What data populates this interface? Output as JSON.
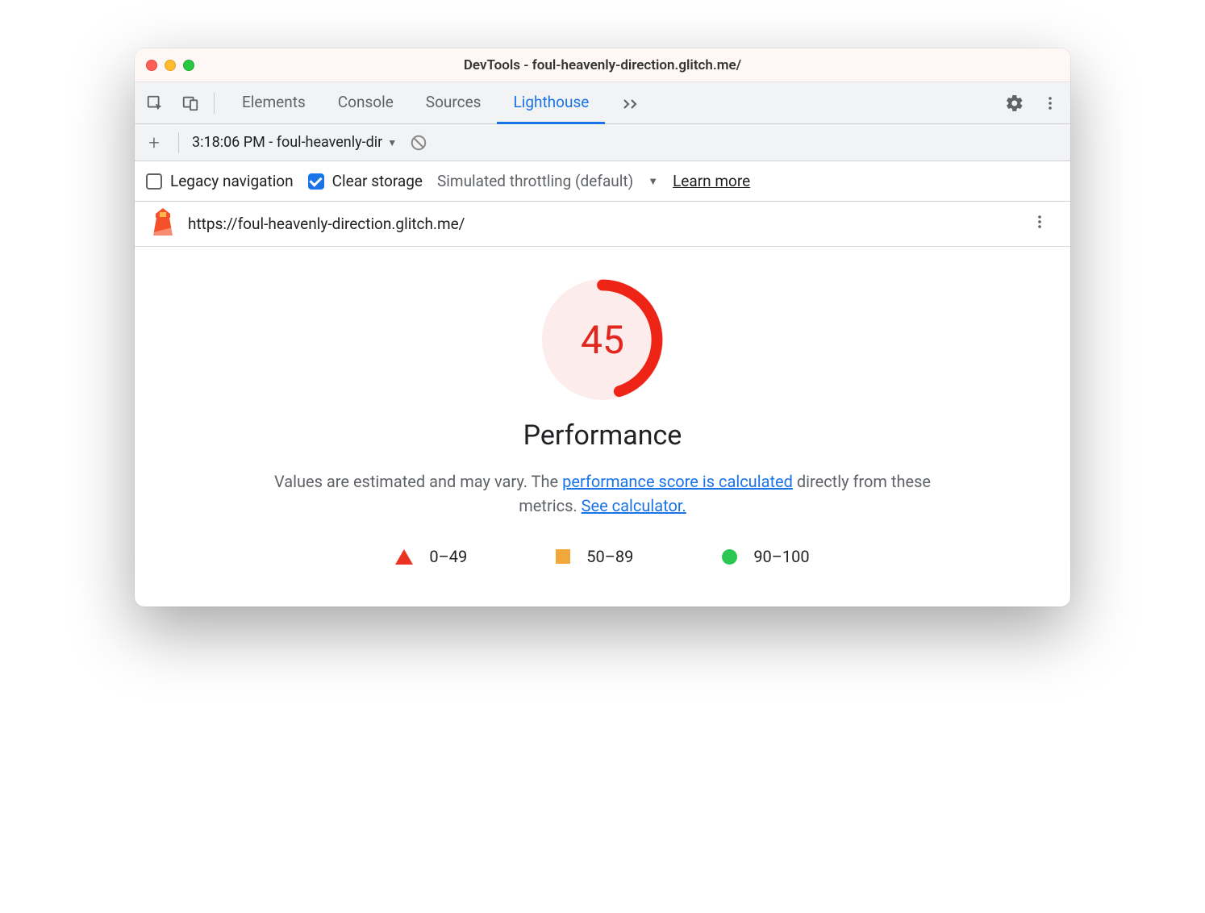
{
  "window": {
    "title": "DevTools - foul-heavenly-direction.glitch.me/"
  },
  "tabs": {
    "items": [
      "Elements",
      "Console",
      "Sources",
      "Lighthouse"
    ],
    "active": "Lighthouse"
  },
  "subbar": {
    "report_label": "3:18:06 PM - foul-heavenly-dir"
  },
  "options": {
    "legacy_nav_label": "Legacy navigation",
    "legacy_nav_checked": false,
    "clear_storage_label": "Clear storage",
    "clear_storage_checked": true,
    "throttle_label": "Simulated throttling (default)",
    "learn_more": "Learn more"
  },
  "url": {
    "text": "https://foul-heavenly-direction.glitch.me/"
  },
  "report": {
    "score": "45",
    "score_fraction": 0.45,
    "category": "Performance",
    "desc_prefix": "Values are estimated and may vary. The ",
    "link1": "performance score is calculated",
    "desc_mid": " directly from these metrics. ",
    "link2": "See calculator."
  },
  "legend": {
    "fail": "0–49",
    "avg": "50–89",
    "pass": "90–100"
  },
  "colors": {
    "fail": "#eb3324",
    "avg": "#f2a73b",
    "pass": "#2ac852",
    "link": "#1a73e8"
  }
}
